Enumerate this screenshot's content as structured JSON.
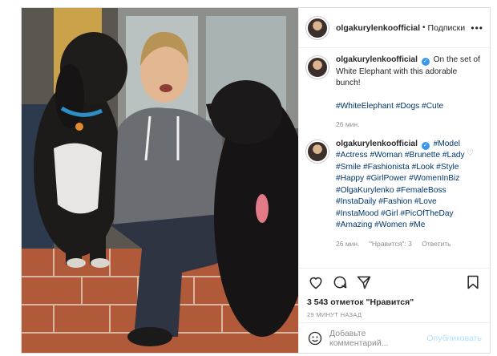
{
  "header": {
    "username": "olgakurylenkoofficial",
    "separator": "•",
    "follow_label": "Подписки",
    "more_label": "•••"
  },
  "caption": {
    "username": "olgakurylenkoofficial",
    "text": "On the set of White Elephant with this adorable bunch!",
    "hashtags": "#WhiteElephant #Dogs #Cute",
    "time": "26 мин."
  },
  "comment": {
    "username": "olgakurylenkoofficial",
    "hashtags": "#Model #Actress #Woman #Brunette #Lady #Smile #Fashionista #Look #Style #Happy #GirlPower #WomenInBiz #OlgaKurylenko #FemaleBoss #InstaDaily #Fashion #Love #InstaMood #Girl #PicOfTheDay #Amazing #Women #Me",
    "time": "26 мин.",
    "likes": "\"Нравится\": 3",
    "reply": "Ответить"
  },
  "likes_line": "3 543 отметок \"Нравится\"",
  "posted_ago": "29 минут назад",
  "add_comment": {
    "placeholder": "Добавьте комментарий...",
    "publish": "Опубликовать"
  },
  "icons": [
    "heart-icon",
    "comment-icon",
    "share-icon",
    "bookmark-icon",
    "emoji-icon",
    "verified-icon"
  ],
  "colors": {
    "link": "#00376b",
    "verified": "#3897f0",
    "muted": "#8e8e8e",
    "publish_disabled": "#b2dffc"
  }
}
